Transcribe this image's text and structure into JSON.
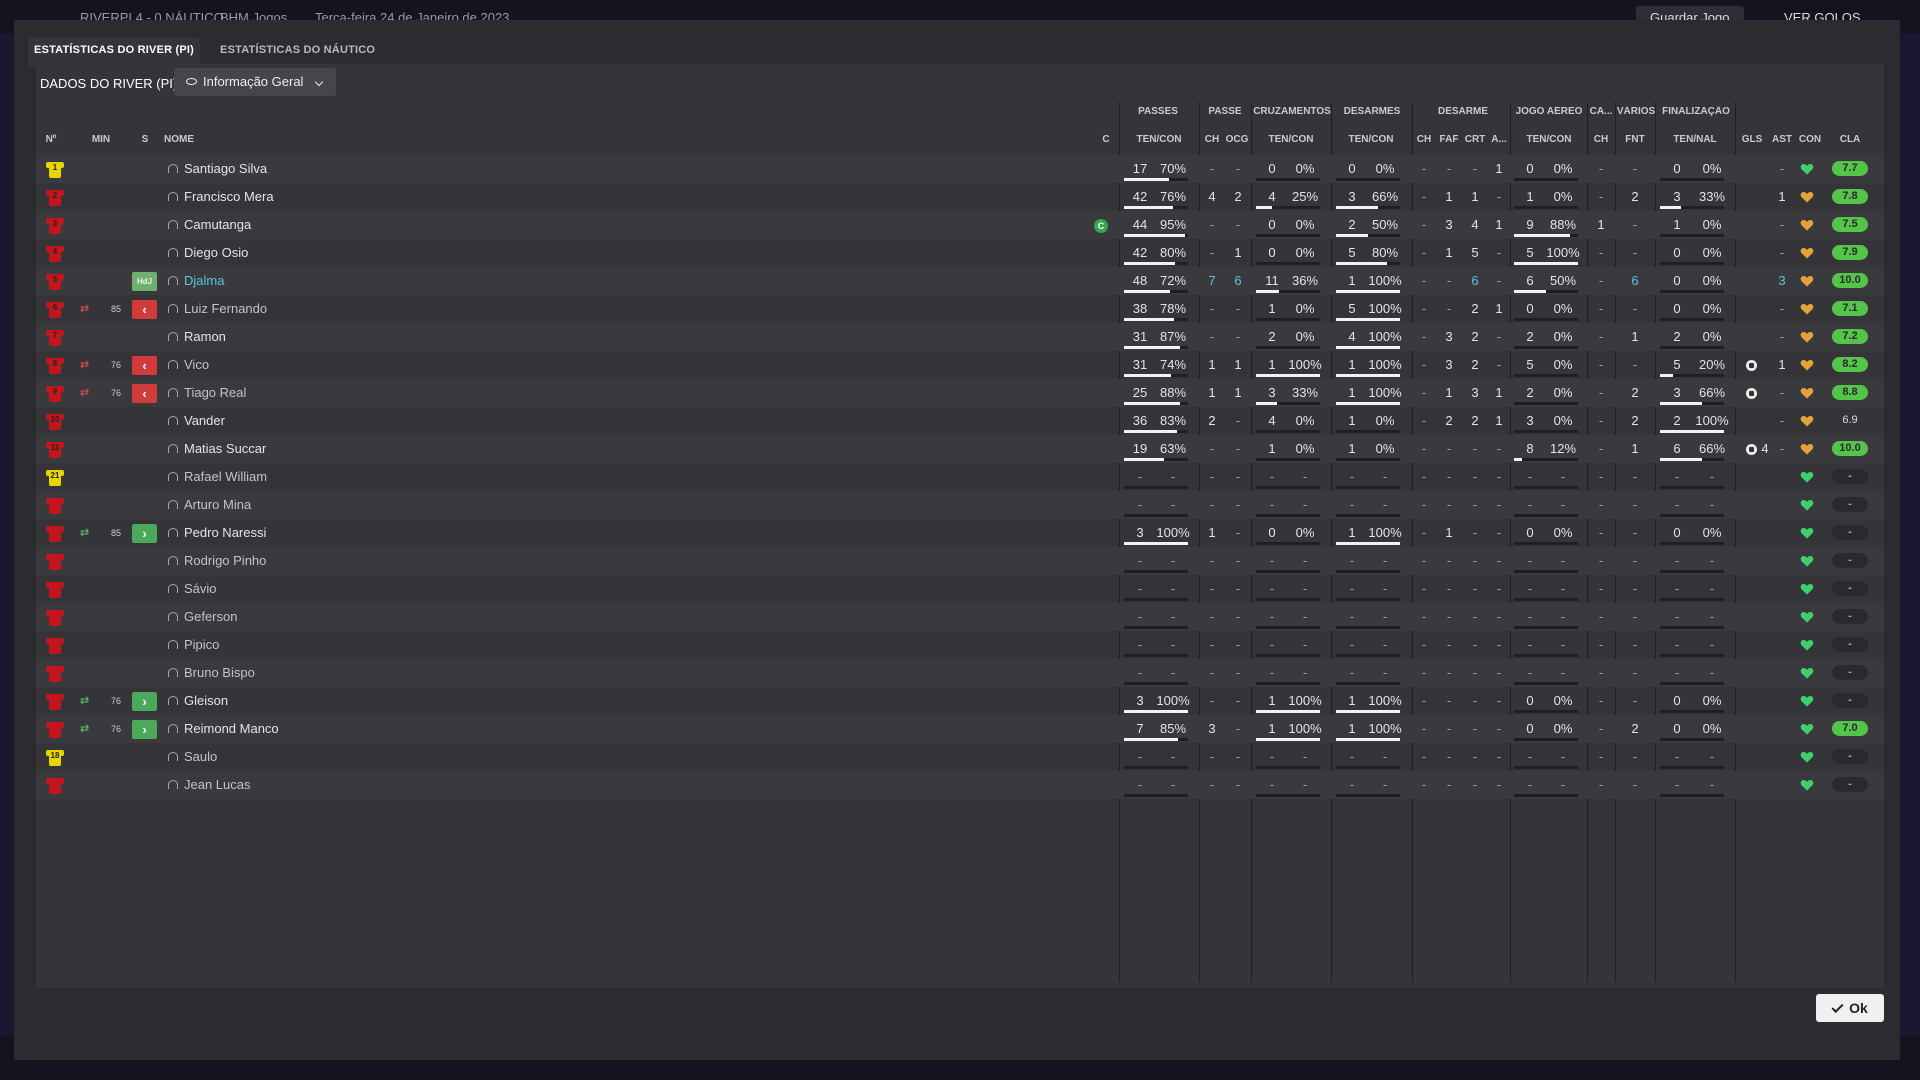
{
  "background": {
    "match_title": "RIVERPI 4 - 0 NÁUTICO",
    "breadcrumb_1": "BHM Jogos",
    "date": "Terça-feira 24 de Janeiro de 2023",
    "save_label": "Guardar Jogo",
    "goals_label": "VER GOLOS"
  },
  "tabs": [
    "ESTATÍSTICAS DO RIVER (PI)",
    "ESTATÍSTICAS DO NÁUTICO"
  ],
  "subheader": {
    "title": "DADOS DO RIVER (PI)",
    "dropdown": "Informação Geral"
  },
  "groups": {
    "passes": "PASSES",
    "passe": "PASSE",
    "cruz": "CRUZAMENTOS",
    "desarmes": "DESARMES",
    "desarme": "DESARME",
    "jogo_aereo": "JOGO AÉREO",
    "ca": "CA...",
    "varios": "VÁRIOS",
    "final": "FINALIZAÇÃO"
  },
  "columns": {
    "no": "Nº",
    "min": "MIN",
    "s": "S",
    "nome": "NOME",
    "c": "C",
    "passes_ten": "TEN/CON",
    "passe_ch": "CH",
    "passe_ocg": "OCG",
    "cruz_ten": "TEN/CON",
    "des_ten": "TEN/CON",
    "d_ch": "CH",
    "d_faf": "FAF",
    "d_crt": "CRT",
    "d_a": "A...",
    "ja_ten": "TEN/CON",
    "ca_ch": "CH",
    "var_fnt": "FNT",
    "fin_ten": "TEN/NAL",
    "gls": "GLS",
    "ast": "AST",
    "con": "CON",
    "cla": "CLA"
  },
  "players": [
    {
      "no": "1",
      "gk": true,
      "min": "",
      "sub": "",
      "name": "Santiago Silva",
      "style": "",
      "cap": false,
      "p": [
        "17",
        "70%"
      ],
      "pf": 0.7,
      "ch": "-",
      "ocg": "-",
      "cr": [
        "0",
        "0%"
      ],
      "crf": 0,
      "de": [
        "0",
        "0%"
      ],
      "def": 0,
      "dch": "-",
      "faf": "-",
      "crt": "-",
      "a": "1",
      "ja": [
        "0",
        "0%"
      ],
      "jaf": 0,
      "cach": "-",
      "fnt": "-",
      "fi": [
        "0",
        "0%"
      ],
      "fif": 0,
      "gls": "",
      "ast": "-",
      "con": "green",
      "cla": "7.7",
      "clac": "g"
    },
    {
      "no": "2",
      "gk": false,
      "min": "",
      "sub": "",
      "name": "Francisco Mera",
      "style": "",
      "cap": false,
      "p": [
        "42",
        "76%"
      ],
      "pf": 0.76,
      "ch": "4",
      "ocg": "2",
      "cr": [
        "4",
        "25%"
      ],
      "crf": 0.25,
      "de": [
        "3",
        "66%"
      ],
      "def": 0.66,
      "dch": "-",
      "faf": "1",
      "crt": "1",
      "a": "-",
      "ja": [
        "1",
        "0%"
      ],
      "jaf": 0,
      "cach": "-",
      "fnt": "2",
      "fi": [
        "3",
        "33%"
      ],
      "fif": 0.33,
      "gls": "",
      "ast": "1",
      "con": "orange",
      "cla": "7.8",
      "clac": "g"
    },
    {
      "no": "3",
      "gk": false,
      "min": "",
      "sub": "",
      "name": "Camutanga",
      "style": "",
      "cap": true,
      "p": [
        "44",
        "95%"
      ],
      "pf": 0.95,
      "ch": "-",
      "ocg": "-",
      "cr": [
        "0",
        "0%"
      ],
      "crf": 0,
      "de": [
        "2",
        "50%"
      ],
      "def": 0.5,
      "dch": "-",
      "faf": "3",
      "crt": "4",
      "a": "1",
      "ja": [
        "9",
        "88%"
      ],
      "jaf": 0.88,
      "cach": "1",
      "fnt": "-",
      "fi": [
        "1",
        "0%"
      ],
      "fif": 0,
      "gls": "",
      "ast": "-",
      "con": "orange",
      "cla": "7.5",
      "clac": "g"
    },
    {
      "no": "4",
      "gk": false,
      "min": "",
      "sub": "",
      "name": "Diego Osio",
      "style": "",
      "cap": false,
      "p": [
        "42",
        "80%"
      ],
      "pf": 0.8,
      "ch": "-",
      "ocg": "1",
      "cr": [
        "0",
        "0%"
      ],
      "crf": 0,
      "de": [
        "5",
        "80%"
      ],
      "def": 0.8,
      "dch": "-",
      "faf": "1",
      "crt": "5",
      "a": "-",
      "ja": [
        "5",
        "100%"
      ],
      "jaf": 1,
      "cach": "-",
      "fnt": "-",
      "fi": [
        "0",
        "0%"
      ],
      "fif": 0,
      "gls": "",
      "ast": "-",
      "con": "orange",
      "cla": "7.9",
      "clac": "g"
    },
    {
      "no": "5",
      "gk": false,
      "min": "",
      "sub": "hdj",
      "name": "Djalma",
      "style": "cap",
      "cap": false,
      "p": [
        "48",
        "72%"
      ],
      "pf": 0.72,
      "ch": "7",
      "ocg": "6",
      "cr": [
        "11",
        "36%"
      ],
      "crf": 0.36,
      "de": [
        "1",
        "100%"
      ],
      "def": 1,
      "dch": "-",
      "faf": "-",
      "crt": "6",
      "a": "-",
      "ja": [
        "6",
        "50%"
      ],
      "jaf": 0.5,
      "cach": "-",
      "fnt": "6",
      "fi": [
        "0",
        "0%"
      ],
      "fif": 0,
      "gls": "",
      "ast": "3",
      "con": "orange",
      "cla": "10.0",
      "clac": "g",
      "cyan": true
    },
    {
      "no": "6",
      "gk": false,
      "min": "85",
      "sub": "off",
      "name": "Luiz Fernando",
      "style": "unused",
      "cap": false,
      "p": [
        "38",
        "78%"
      ],
      "pf": 0.78,
      "ch": "-",
      "ocg": "-",
      "cr": [
        "1",
        "0%"
      ],
      "crf": 0,
      "de": [
        "5",
        "100%"
      ],
      "def": 1,
      "dch": "-",
      "faf": "-",
      "crt": "2",
      "a": "1",
      "ja": [
        "0",
        "0%"
      ],
      "jaf": 0,
      "cach": "-",
      "fnt": "-",
      "fi": [
        "0",
        "0%"
      ],
      "fif": 0,
      "gls": "",
      "ast": "-",
      "con": "orange",
      "cla": "7.1",
      "clac": "g"
    },
    {
      "no": "7",
      "gk": false,
      "min": "",
      "sub": "",
      "name": "Ramon",
      "style": "",
      "cap": false,
      "p": [
        "31",
        "87%"
      ],
      "pf": 0.87,
      "ch": "-",
      "ocg": "-",
      "cr": [
        "2",
        "0%"
      ],
      "crf": 0,
      "de": [
        "4",
        "100%"
      ],
      "def": 1,
      "dch": "-",
      "faf": "3",
      "crt": "2",
      "a": "-",
      "ja": [
        "2",
        "0%"
      ],
      "jaf": 0,
      "cach": "-",
      "fnt": "1",
      "fi": [
        "2",
        "0%"
      ],
      "fif": 0,
      "gls": "",
      "ast": "-",
      "con": "orange",
      "cla": "7.2",
      "clac": "g"
    },
    {
      "no": "8",
      "gk": false,
      "min": "76",
      "sub": "off",
      "name": "Vico",
      "style": "unused",
      "cap": false,
      "p": [
        "31",
        "74%"
      ],
      "pf": 0.74,
      "ch": "1",
      "ocg": "1",
      "cr": [
        "1",
        "100%"
      ],
      "crf": 1,
      "de": [
        "1",
        "100%"
      ],
      "def": 1,
      "dch": "-",
      "faf": "3",
      "crt": "2",
      "a": "-",
      "ja": [
        "5",
        "0%"
      ],
      "jaf": 0,
      "cach": "-",
      "fnt": "-",
      "fi": [
        "5",
        "20%"
      ],
      "fif": 0.2,
      "gls": "1",
      "ast": "1",
      "con": "orange",
      "cla": "8.2",
      "clac": "g"
    },
    {
      "no": "9",
      "gk": false,
      "min": "76",
      "sub": "off",
      "name": "Tiago Real",
      "style": "unused",
      "cap": false,
      "p": [
        "25",
        "88%"
      ],
      "pf": 0.88,
      "ch": "1",
      "ocg": "1",
      "cr": [
        "3",
        "33%"
      ],
      "crf": 0.33,
      "de": [
        "1",
        "100%"
      ],
      "def": 1,
      "dch": "-",
      "faf": "1",
      "crt": "3",
      "a": "1",
      "ja": [
        "2",
        "0%"
      ],
      "jaf": 0,
      "cach": "-",
      "fnt": "2",
      "fi": [
        "3",
        "66%"
      ],
      "fif": 0.66,
      "gls": "1",
      "ast": "-",
      "con": "orange",
      "cla": "8.8",
      "clac": "g"
    },
    {
      "no": "10",
      "gk": false,
      "min": "",
      "sub": "",
      "name": "Vander",
      "style": "",
      "cap": false,
      "p": [
        "36",
        "83%"
      ],
      "pf": 0.83,
      "ch": "2",
      "ocg": "-",
      "cr": [
        "4",
        "0%"
      ],
      "crf": 0,
      "de": [
        "1",
        "0%"
      ],
      "def": 0,
      "dch": "-",
      "faf": "2",
      "crt": "2",
      "a": "1",
      "ja": [
        "3",
        "0%"
      ],
      "jaf": 0,
      "cach": "-",
      "fnt": "2",
      "fi": [
        "2",
        "100%"
      ],
      "fif": 1,
      "gls": "",
      "ast": "-",
      "con": "orange",
      "cla": "6.9",
      "clac": "plain"
    },
    {
      "no": "11",
      "gk": false,
      "min": "",
      "sub": "",
      "name": "Matias Succar",
      "style": "",
      "cap": false,
      "p": [
        "19",
        "63%"
      ],
      "pf": 0.63,
      "ch": "-",
      "ocg": "-",
      "cr": [
        "1",
        "0%"
      ],
      "crf": 0,
      "de": [
        "1",
        "0%"
      ],
      "def": 0,
      "dch": "-",
      "faf": "-",
      "crt": "-",
      "a": "-",
      "ja": [
        "8",
        "12%"
      ],
      "jaf": 0.12,
      "cach": "-",
      "fnt": "1",
      "fi": [
        "6",
        "66%"
      ],
      "fif": 0.66,
      "gls": "4",
      "ast": "-",
      "con": "orange",
      "cla": "10.0",
      "clac": "g"
    },
    {
      "no": "21",
      "gk": true,
      "min": "",
      "sub": "",
      "name": "Rafael William",
      "style": "unused",
      "cap": false,
      "p": [
        "-",
        "-"
      ],
      "pf": 0,
      "ch": "-",
      "ocg": "-",
      "cr": [
        "-",
        "-"
      ],
      "crf": 0,
      "de": [
        "-",
        "-"
      ],
      "def": 0,
      "dch": "-",
      "faf": "-",
      "crt": "-",
      "a": "-",
      "ja": [
        "-",
        "-"
      ],
      "jaf": 0,
      "cach": "-",
      "fnt": "-",
      "fi": [
        "-",
        "-"
      ],
      "fif": 0,
      "gls": "",
      "ast": "",
      "con": "green",
      "cla": "-",
      "clac": "none"
    },
    {
      "no": "",
      "gk": false,
      "min": "",
      "sub": "",
      "name": "Arturo Mina",
      "style": "unused",
      "cap": false,
      "p": [
        "-",
        "-"
      ],
      "pf": 0,
      "ch": "-",
      "ocg": "-",
      "cr": [
        "-",
        "-"
      ],
      "crf": 0,
      "de": [
        "-",
        "-"
      ],
      "def": 0,
      "dch": "-",
      "faf": "-",
      "crt": "-",
      "a": "-",
      "ja": [
        "-",
        "-"
      ],
      "jaf": 0,
      "cach": "-",
      "fnt": "-",
      "fi": [
        "-",
        "-"
      ],
      "fif": 0,
      "gls": "",
      "ast": "",
      "con": "green",
      "cla": "-",
      "clac": "none"
    },
    {
      "no": "",
      "gk": false,
      "min": "85",
      "sub": "on",
      "name": "Pedro Naressi",
      "style": "",
      "cap": false,
      "p": [
        "3",
        "100%"
      ],
      "pf": 1,
      "ch": "1",
      "ocg": "-",
      "cr": [
        "0",
        "0%"
      ],
      "crf": 0,
      "de": [
        "1",
        "100%"
      ],
      "def": 1,
      "dch": "-",
      "faf": "1",
      "crt": "-",
      "a": "-",
      "ja": [
        "0",
        "0%"
      ],
      "jaf": 0,
      "cach": "-",
      "fnt": "-",
      "fi": [
        "0",
        "0%"
      ],
      "fif": 0,
      "gls": "",
      "ast": "",
      "con": "green",
      "cla": "-",
      "clac": "none"
    },
    {
      "no": "",
      "gk": false,
      "min": "",
      "sub": "",
      "name": "Rodrigo Pinho",
      "style": "unused",
      "cap": false,
      "p": [
        "-",
        "-"
      ],
      "pf": 0,
      "ch": "-",
      "ocg": "-",
      "cr": [
        "-",
        "-"
      ],
      "crf": 0,
      "de": [
        "-",
        "-"
      ],
      "def": 0,
      "dch": "-",
      "faf": "-",
      "crt": "-",
      "a": "-",
      "ja": [
        "-",
        "-"
      ],
      "jaf": 0,
      "cach": "-",
      "fnt": "-",
      "fi": [
        "-",
        "-"
      ],
      "fif": 0,
      "gls": "",
      "ast": "",
      "con": "green",
      "cla": "-",
      "clac": "none"
    },
    {
      "no": "",
      "gk": false,
      "min": "",
      "sub": "",
      "name": "Sávio",
      "style": "unused",
      "cap": false,
      "p": [
        "-",
        "-"
      ],
      "pf": 0,
      "ch": "-",
      "ocg": "-",
      "cr": [
        "-",
        "-"
      ],
      "crf": 0,
      "de": [
        "-",
        "-"
      ],
      "def": 0,
      "dch": "-",
      "faf": "-",
      "crt": "-",
      "a": "-",
      "ja": [
        "-",
        "-"
      ],
      "jaf": 0,
      "cach": "-",
      "fnt": "-",
      "fi": [
        "-",
        "-"
      ],
      "fif": 0,
      "gls": "",
      "ast": "",
      "con": "green",
      "cla": "-",
      "clac": "none"
    },
    {
      "no": "",
      "gk": false,
      "min": "",
      "sub": "",
      "name": "Geferson",
      "style": "unused",
      "cap": false,
      "p": [
        "-",
        "-"
      ],
      "pf": 0,
      "ch": "-",
      "ocg": "-",
      "cr": [
        "-",
        "-"
      ],
      "crf": 0,
      "de": [
        "-",
        "-"
      ],
      "def": 0,
      "dch": "-",
      "faf": "-",
      "crt": "-",
      "a": "-",
      "ja": [
        "-",
        "-"
      ],
      "jaf": 0,
      "cach": "-",
      "fnt": "-",
      "fi": [
        "-",
        "-"
      ],
      "fif": 0,
      "gls": "",
      "ast": "",
      "con": "green",
      "cla": "-",
      "clac": "none"
    },
    {
      "no": "",
      "gk": false,
      "min": "",
      "sub": "",
      "name": "Pipico",
      "style": "unused",
      "cap": false,
      "p": [
        "-",
        "-"
      ],
      "pf": 0,
      "ch": "-",
      "ocg": "-",
      "cr": [
        "-",
        "-"
      ],
      "crf": 0,
      "de": [
        "-",
        "-"
      ],
      "def": 0,
      "dch": "-",
      "faf": "-",
      "crt": "-",
      "a": "-",
      "ja": [
        "-",
        "-"
      ],
      "jaf": 0,
      "cach": "-",
      "fnt": "-",
      "fi": [
        "-",
        "-"
      ],
      "fif": 0,
      "gls": "",
      "ast": "",
      "con": "green",
      "cla": "-",
      "clac": "none"
    },
    {
      "no": "",
      "gk": false,
      "min": "",
      "sub": "",
      "name": "Bruno Bispo",
      "style": "unused",
      "cap": false,
      "p": [
        "-",
        "-"
      ],
      "pf": 0,
      "ch": "-",
      "ocg": "-",
      "cr": [
        "-",
        "-"
      ],
      "crf": 0,
      "de": [
        "-",
        "-"
      ],
      "def": 0,
      "dch": "-",
      "faf": "-",
      "crt": "-",
      "a": "-",
      "ja": [
        "-",
        "-"
      ],
      "jaf": 0,
      "cach": "-",
      "fnt": "-",
      "fi": [
        "-",
        "-"
      ],
      "fif": 0,
      "gls": "",
      "ast": "",
      "con": "green",
      "cla": "-",
      "clac": "none"
    },
    {
      "no": "",
      "gk": false,
      "min": "76",
      "sub": "on",
      "name": "Gleison",
      "style": "",
      "cap": false,
      "p": [
        "3",
        "100%"
      ],
      "pf": 1,
      "ch": "-",
      "ocg": "-",
      "cr": [
        "1",
        "100%"
      ],
      "crf": 1,
      "de": [
        "1",
        "100%"
      ],
      "def": 1,
      "dch": "-",
      "faf": "-",
      "crt": "-",
      "a": "-",
      "ja": [
        "0",
        "0%"
      ],
      "jaf": 0,
      "cach": "-",
      "fnt": "-",
      "fi": [
        "0",
        "0%"
      ],
      "fif": 0,
      "gls": "",
      "ast": "",
      "con": "green",
      "cla": "-",
      "clac": "none"
    },
    {
      "no": "",
      "gk": false,
      "min": "76",
      "sub": "on",
      "name": "Reimond Manco",
      "style": "",
      "cap": false,
      "p": [
        "7",
        "85%"
      ],
      "pf": 0.85,
      "ch": "3",
      "ocg": "-",
      "cr": [
        "1",
        "100%"
      ],
      "crf": 1,
      "de": [
        "1",
        "100%"
      ],
      "def": 1,
      "dch": "-",
      "faf": "-",
      "crt": "-",
      "a": "-",
      "ja": [
        "0",
        "0%"
      ],
      "jaf": 0,
      "cach": "-",
      "fnt": "2",
      "fi": [
        "0",
        "0%"
      ],
      "fif": 0,
      "gls": "",
      "ast": "",
      "con": "green",
      "cla": "7.0",
      "clac": "g"
    },
    {
      "no": "18",
      "gk": true,
      "min": "",
      "sub": "",
      "name": "Saulo",
      "style": "unused",
      "cap": false,
      "p": [
        "-",
        "-"
      ],
      "pf": 0,
      "ch": "-",
      "ocg": "-",
      "cr": [
        "-",
        "-"
      ],
      "crf": 0,
      "de": [
        "-",
        "-"
      ],
      "def": 0,
      "dch": "-",
      "faf": "-",
      "crt": "-",
      "a": "-",
      "ja": [
        "-",
        "-"
      ],
      "jaf": 0,
      "cach": "-",
      "fnt": "-",
      "fi": [
        "-",
        "-"
      ],
      "fif": 0,
      "gls": "",
      "ast": "",
      "con": "green",
      "cla": "-",
      "clac": "none"
    },
    {
      "no": "",
      "gk": false,
      "min": "",
      "sub": "",
      "name": "Jean Lucas",
      "style": "unused",
      "cap": false,
      "p": [
        "-",
        "-"
      ],
      "pf": 0,
      "ch": "-",
      "ocg": "-",
      "cr": [
        "-",
        "-"
      ],
      "crf": 0,
      "de": [
        "-",
        "-"
      ],
      "def": 0,
      "dch": "-",
      "faf": "-",
      "crt": "-",
      "a": "-",
      "ja": [
        "-",
        "-"
      ],
      "jaf": 0,
      "cach": "-",
      "fnt": "-",
      "fi": [
        "-",
        "-"
      ],
      "fif": 0,
      "gls": "",
      "ast": "",
      "con": "green",
      "cla": "-",
      "clac": "none"
    }
  ],
  "ok_label": "Ok",
  "colors": {
    "accent_cyan": "#5ac6d8",
    "sub_off": "#d23b3b",
    "sub_on": "#4ca85a",
    "rating_green": "#55c44a",
    "heart_green": "#3ed06a",
    "heart_orange": "#e8a23a"
  }
}
